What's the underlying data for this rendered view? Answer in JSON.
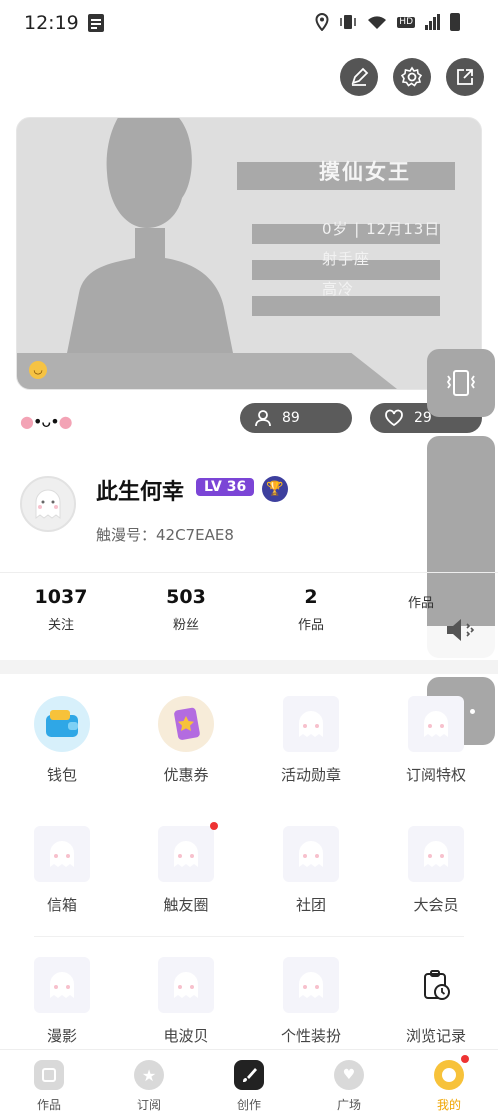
{
  "status_bar": {
    "time": "12:19",
    "network_badge": "HD"
  },
  "card": {
    "name": "摸仙女王",
    "line1": "0岁 | 12月13日",
    "line2": "射手座",
    "line3": "高冷"
  },
  "kaomoji": "•ᴗ•",
  "followers_pill": "89",
  "likes_pill": "29",
  "user": {
    "name": "此生何幸",
    "level": "LV 36",
    "id": "触漫号：42C7EAE8"
  },
  "stats": [
    {
      "value": "1037",
      "label": "关注"
    },
    {
      "value": "503",
      "label": "粉丝"
    },
    {
      "value": "2",
      "label": "作品"
    },
    {
      "value": "",
      "label": "作品"
    }
  ],
  "grid": [
    {
      "label": "钱包",
      "icon": "wallet-icon"
    },
    {
      "label": "优惠券",
      "icon": "coupon-icon"
    },
    {
      "label": "活动勋章",
      "icon": "ghost-placeholder-icon"
    },
    {
      "label": "订阅特权",
      "icon": "ghost-placeholder-icon"
    },
    {
      "label": "信箱",
      "icon": "ghost-placeholder-icon"
    },
    {
      "label": "触友圈",
      "icon": "ghost-placeholder-icon"
    },
    {
      "label": "社团",
      "icon": "ghost-placeholder-icon"
    },
    {
      "label": "大会员",
      "icon": "ghost-placeholder-icon"
    },
    {
      "label": "漫影",
      "icon": "ghost-placeholder-icon"
    },
    {
      "label": "电波贝",
      "icon": "ghost-placeholder-icon"
    },
    {
      "label": "个性装扮",
      "icon": "ghost-placeholder-icon"
    },
    {
      "label": "浏览记录",
      "icon": "history-clock-icon"
    }
  ],
  "nav": [
    {
      "label": "作品"
    },
    {
      "label": "订阅"
    },
    {
      "label": "创作"
    },
    {
      "label": "广场"
    },
    {
      "label": "我的"
    }
  ],
  "colors": {
    "accent": "#f0a500",
    "level_badge": "#7b45d6",
    "notification_dot": "#e33333"
  }
}
